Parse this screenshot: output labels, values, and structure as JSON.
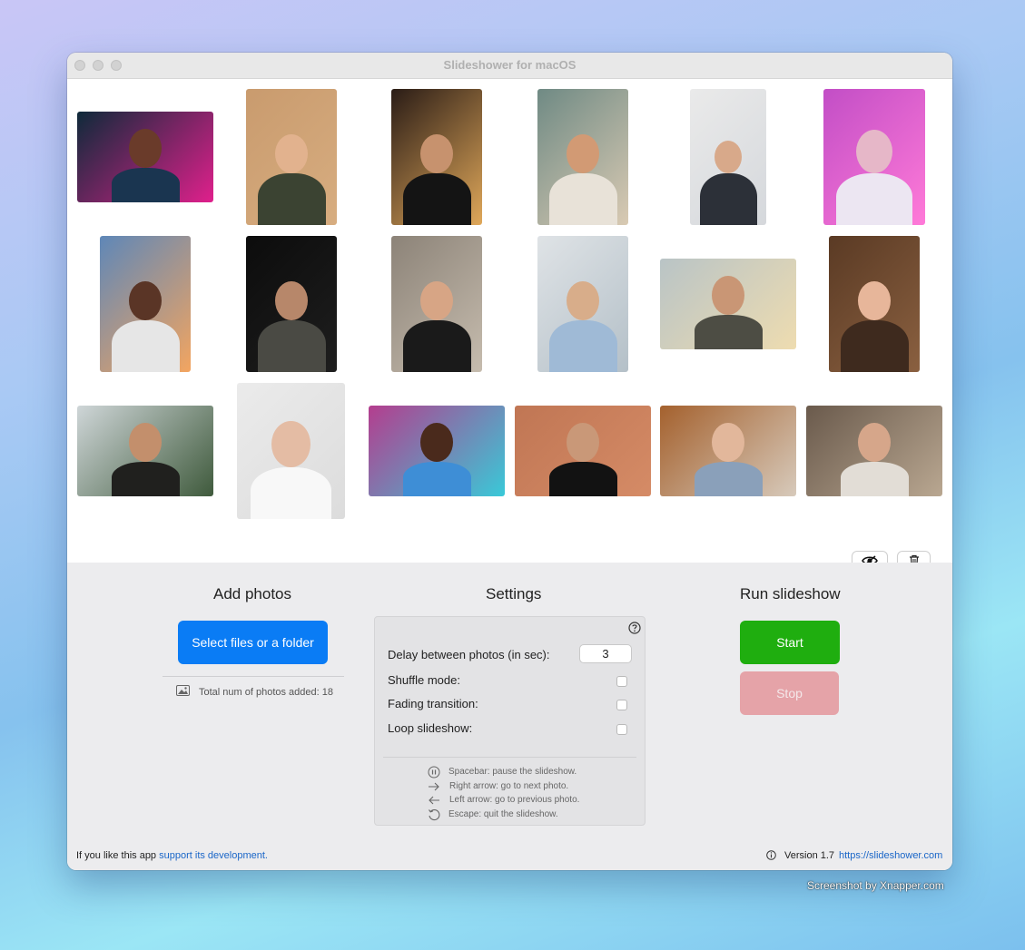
{
  "window": {
    "title": "Slideshower for macOS"
  },
  "photos": [
    {
      "name": "man-neon-lights",
      "bg": "#0e2a3a",
      "accent": "#e0208c",
      "skin": "#6a3b2a",
      "cloth": "#1a3550"
    },
    {
      "name": "woman-tan-background",
      "bg": "#c99b6e",
      "accent": "#d7ad80",
      "skin": "#e2b28e",
      "cloth": "#3b4332"
    },
    {
      "name": "man-bokeh-lights",
      "bg": "#2a1c16",
      "accent": "#e0a85a",
      "skin": "#c7926e",
      "cloth": "#141414"
    },
    {
      "name": "woman-sunglasses-peace",
      "bg": "#6f8a84",
      "accent": "#d9cab3",
      "skin": "#d29a74",
      "cloth": "#e8e2d8"
    },
    {
      "name": "man-arms-crossed",
      "bg": "#eaeaea",
      "accent": "#d5d8dc",
      "skin": "#d8a98a",
      "cloth": "#2c3038"
    },
    {
      "name": "woman-pink-light",
      "bg": "#c24ec6",
      "accent": "#ff7ad8",
      "skin": "#e6b7c8",
      "cloth": "#ece6f2"
    },
    {
      "name": "woman-city-view",
      "bg": "#5e87b8",
      "accent": "#f3a560",
      "skin": "#5a3526",
      "cloth": "#e6e6e6"
    },
    {
      "name": "man-dark-portrait",
      "bg": "#0c0c0c",
      "accent": "#1e1e1e",
      "skin": "#b7876a",
      "cloth": "#4a4a44"
    },
    {
      "name": "woman-striped-wall",
      "bg": "#8c8378",
      "accent": "#c6bcae",
      "skin": "#d7a585",
      "cloth": "#1a1a1a"
    },
    {
      "name": "man-blue-shirt-office",
      "bg": "#dfe3e6",
      "accent": "#b4c0c8",
      "skin": "#d8ad8a",
      "cloth": "#9fbad6"
    },
    {
      "name": "friends-outdoor-group",
      "bg": "#b9c4c6",
      "accent": "#eedcb0",
      "skin": "#c99675",
      "cloth": "#4d4d44"
    },
    {
      "name": "redhead-smiling",
      "bg": "#5a3a24",
      "accent": "#8a6040",
      "skin": "#e7b69a",
      "cloth": "#3e2a1e"
    },
    {
      "name": "three-friends-trees",
      "bg": "#cfd6d8",
      "accent": "#3f5a3c",
      "skin": "#c38f6c",
      "cloth": "#20201e"
    },
    {
      "name": "woman-white-tshirt",
      "bg": "#ebebeb",
      "accent": "#dcdcdc",
      "skin": "#e4bca4",
      "cloth": "#f8f8f8"
    },
    {
      "name": "man-graffiti-wall",
      "bg": "#b43d8e",
      "accent": "#39c9d8",
      "skin": "#4a2a1c",
      "cloth": "#3e8ed6"
    },
    {
      "name": "man-hat-orange-wall",
      "bg": "#c07654",
      "accent": "#d58b66",
      "skin": "#c99878",
      "cloth": "#121212"
    },
    {
      "name": "friends-cafe-table",
      "bg": "#a4612e",
      "accent": "#d7cabb",
      "skin": "#e2b79b",
      "cloth": "#8aa0ba"
    },
    {
      "name": "women-laptop-table",
      "bg": "#6a5a4c",
      "accent": "#b9a791",
      "skin": "#d6a68a",
      "cloth": "#e2ddd6"
    }
  ],
  "toolbar": {
    "hide_icon": "eye-slash-icon",
    "delete_icon": "trash-icon"
  },
  "add_photos": {
    "title": "Add photos",
    "select_button": "Select files or a folder",
    "total_label": "Total num of photos added: 18"
  },
  "settings": {
    "title": "Settings",
    "help_icon": "question-circle-icon",
    "delay_label": "Delay between photos (in sec):",
    "delay_value": "3",
    "shuffle_label": "Shuffle mode:",
    "fading_label": "Fading transition:",
    "loop_label": "Loop slideshow:",
    "shuffle_checked": false,
    "fading_checked": false,
    "loop_checked": false,
    "hints": [
      "Spacebar: pause the slideshow.",
      "Right arrow: go to next photo.",
      "Left arrow: go to previous photo.",
      "Escape: quit the slideshow."
    ]
  },
  "run": {
    "title": "Run slideshow",
    "start_label": "Start",
    "stop_label": "Stop"
  },
  "footer": {
    "support_prefix": "If you like this app",
    "support_link": "support its development.",
    "version": "Version 1.7",
    "website": "https://slideshower.com"
  },
  "credit": "Screenshot by Xnapper.com",
  "colors": {
    "accent_blue": "#0a7cf5",
    "start_green": "#1fae0f",
    "stop_disabled": "#e5a3a8",
    "link": "#1a66c8"
  }
}
